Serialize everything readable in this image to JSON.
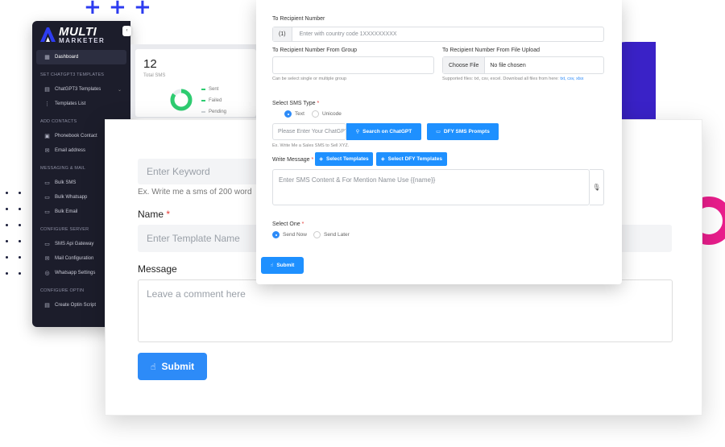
{
  "logo": {
    "line1": "MULTI",
    "line2": "MARKETER"
  },
  "colors": {
    "accent": "#2d8bf8",
    "sidebar_bg": "#1c1d2b",
    "blob_purple": "#3a22c7",
    "ring_pink": "#e91e8c",
    "donut_green": "#2ecc71"
  },
  "sidebar": {
    "collapse_icon": "‹",
    "dashboard": "Dashboard",
    "sections": [
      {
        "title": "SET CHATGPT3 TEMPLATES",
        "items": [
          "ChatGPT3 Templates",
          "Templates List"
        ]
      },
      {
        "title": "ADD CONTACTS",
        "items": [
          "Phonebook Contact",
          "Email address"
        ]
      },
      {
        "title": "MESSAGING & MAIL",
        "items": [
          "Bulk SMS",
          "Bulk Whatsapp",
          "Bulk Email"
        ]
      },
      {
        "title": "CONFIGURE SERVER",
        "items": [
          "SMS Api Gateway",
          "Mail Configuration",
          "Whatsapp Settings"
        ]
      },
      {
        "title": "CONFIGURE OPTIN",
        "items": [
          "Create Optin Script"
        ]
      }
    ]
  },
  "stat": {
    "value": "12",
    "label": "Total SMS",
    "legend": [
      "Sent",
      "Failed",
      "Pending"
    ],
    "sent_fraction": 0.85
  },
  "bigform": {
    "keyword_placeholder": "Enter Keyword",
    "keyword_help": "Ex. Write me a sms of 200 word",
    "name_label": "Name",
    "required_mark": "*",
    "name_placeholder": "Enter Template Name",
    "message_label": "Message",
    "message_placeholder": "Leave a comment here",
    "submit": "Submit"
  },
  "front": {
    "recipient_label": "To Recipient Number",
    "recipient_prefix": "(1)",
    "recipient_placeholder": "Enter with country code 1XXXXXXXXX",
    "group_label": "To Recipient Number From Group",
    "group_help": "Can be select single or multiple group",
    "file_label": "To Recipient Number From File Upload",
    "file_choose": "Choose File",
    "file_none": "No file chosen",
    "file_help_prefix": "Supported files: txt, csv, excel. Download all files from here:",
    "file_links": "txt, csv, xlsx",
    "sms_type_label": "Select SMS Type",
    "required_mark": "*",
    "sms_type_options": [
      "Text",
      "Unicode"
    ],
    "chatgpt_placeholder": "Please Enter Your ChatGPT",
    "search_chatgpt": "Search on ChatGPT",
    "dfy_prompts": "DFY SMS Prompts",
    "chatgpt_help": "Ex. Write Me a Sales SMS to Sell XYZ.",
    "write_message_label": "Write Message",
    "select_templates": "Select Templates",
    "select_dfy_templates": "Select DFY Templates",
    "message_placeholder": "Enter SMS Content &  For Mention Name Use  {{name}}",
    "select_one_label": "Select One",
    "send_options": [
      "Send Now",
      "Send Later"
    ],
    "submit": "Submit"
  }
}
